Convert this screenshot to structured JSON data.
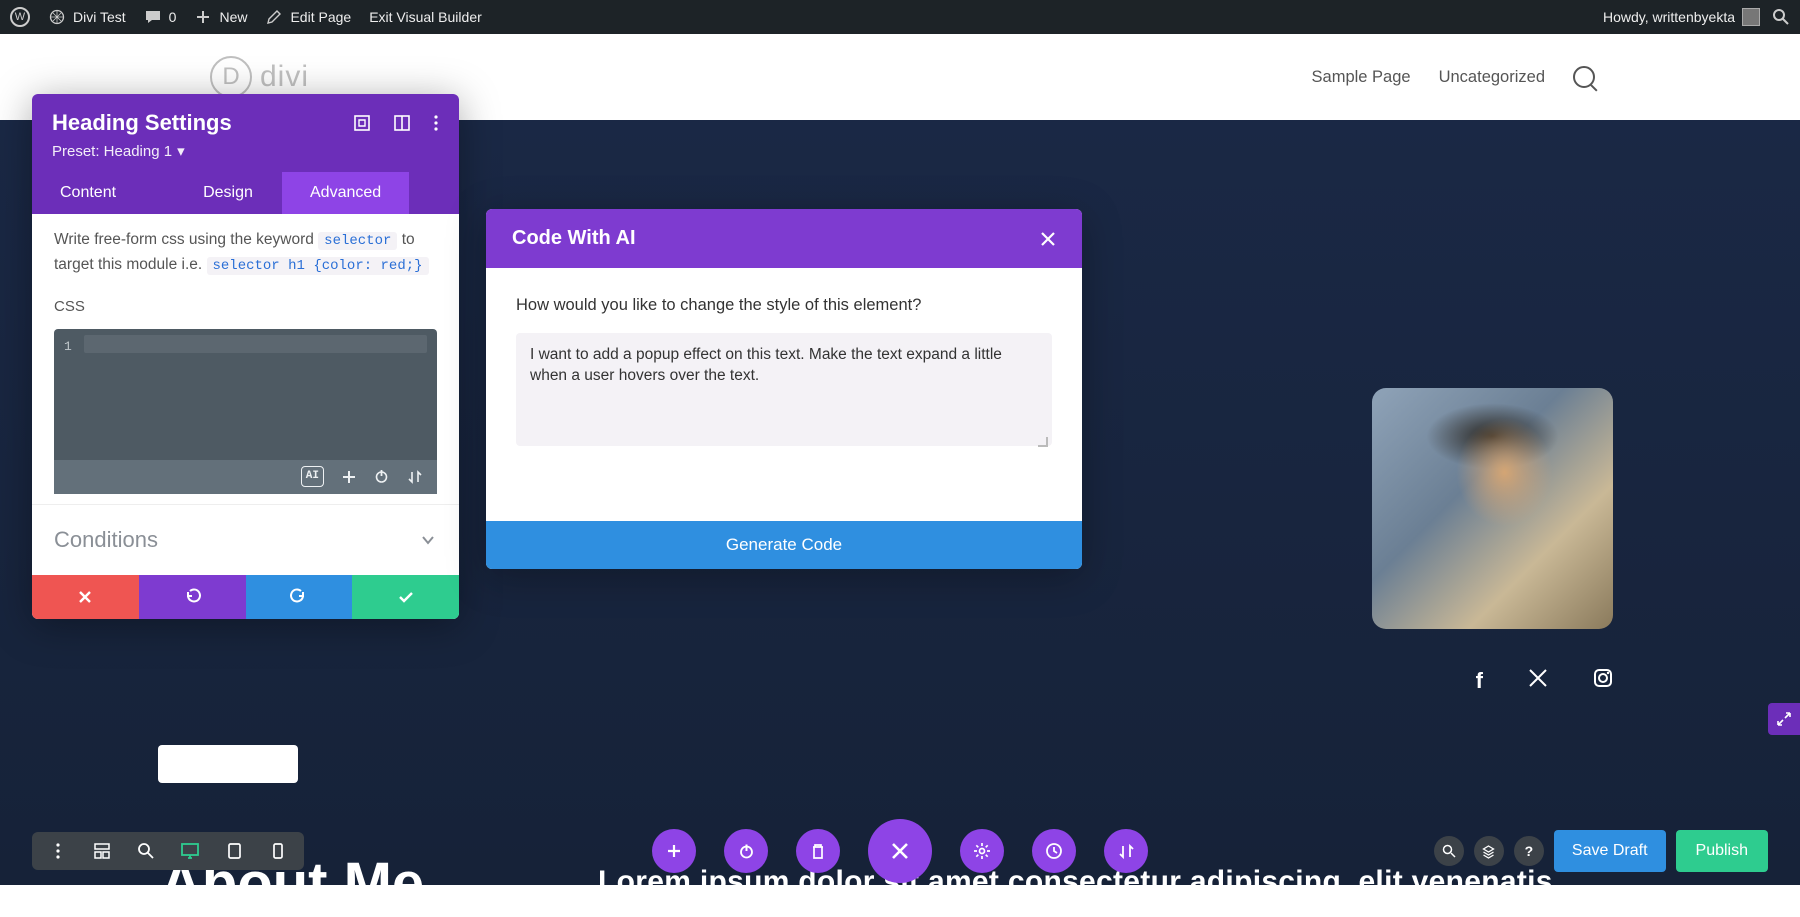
{
  "wp_bar": {
    "site_name": "Divi Test",
    "comments_count": "0",
    "new_label": "New",
    "edit_page": "Edit Page",
    "exit_vb": "Exit Visual Builder",
    "howdy": "Howdy, writtenbyekta"
  },
  "site_header": {
    "logo_letter": "D",
    "logo_word": "divi",
    "nav": {
      "sample_page": "Sample Page",
      "uncategorized": "Uncategorized"
    }
  },
  "hero": {
    "about_me": "About Me",
    "lorem": "Lorem ipsum dolor sit amet consectetur adipiscing, elit venenatis"
  },
  "settings_panel": {
    "title": "Heading Settings",
    "preset_label": "Preset: Heading 1",
    "tabs": {
      "content": "Content",
      "design": "Design",
      "advanced": "Advanced"
    },
    "helper_pre": "Write free-form css using the keyword ",
    "helper_kw1": "selector",
    "helper_mid": "  to target this module i.e. ",
    "helper_kw2": "selector h1 {color: red;}",
    "css_label": "CSS",
    "code_line_number": "1",
    "ai_badge": "AI",
    "conditions_label": "Conditions"
  },
  "ai_modal": {
    "title": "Code With AI",
    "prompt": "How would you like to change the style of this element?",
    "textarea_value": "I want to add a popup effect on this text. Make the text expand a little when a user hovers over the text. ",
    "generate_label": "Generate Code"
  },
  "builder_bar": {
    "save_draft": "Save Draft",
    "publish": "Publish"
  }
}
